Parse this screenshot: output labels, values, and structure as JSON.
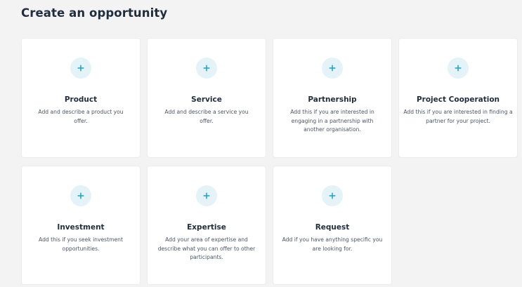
{
  "page": {
    "title": "Create an opportunity"
  },
  "colors": {
    "background": "#f3f3f4",
    "card": "#ffffff",
    "accent": "#1aa3c8",
    "icon_circle": "#e3f3f8",
    "title_text": "#1f2d3d"
  },
  "icons": {
    "add": "plus-icon"
  },
  "cards": [
    {
      "title": "Product",
      "description": "Add and describe a product you offer."
    },
    {
      "title": "Service",
      "description": "Add and describe a service you offer."
    },
    {
      "title": "Partnership",
      "description": "Add this if you are interested in engaging in a partnership with another organisation."
    },
    {
      "title": "Project Cooperation",
      "description": "Add this if you are interested in finding a partner for your project."
    },
    {
      "title": "Investment",
      "description": "Add this if you seek investment opportunities."
    },
    {
      "title": "Expertise",
      "description": "Add your area of expertise and describe what you can offer to other participants."
    },
    {
      "title": "Request",
      "description": "Add if you have anything specific you are looking for."
    }
  ]
}
